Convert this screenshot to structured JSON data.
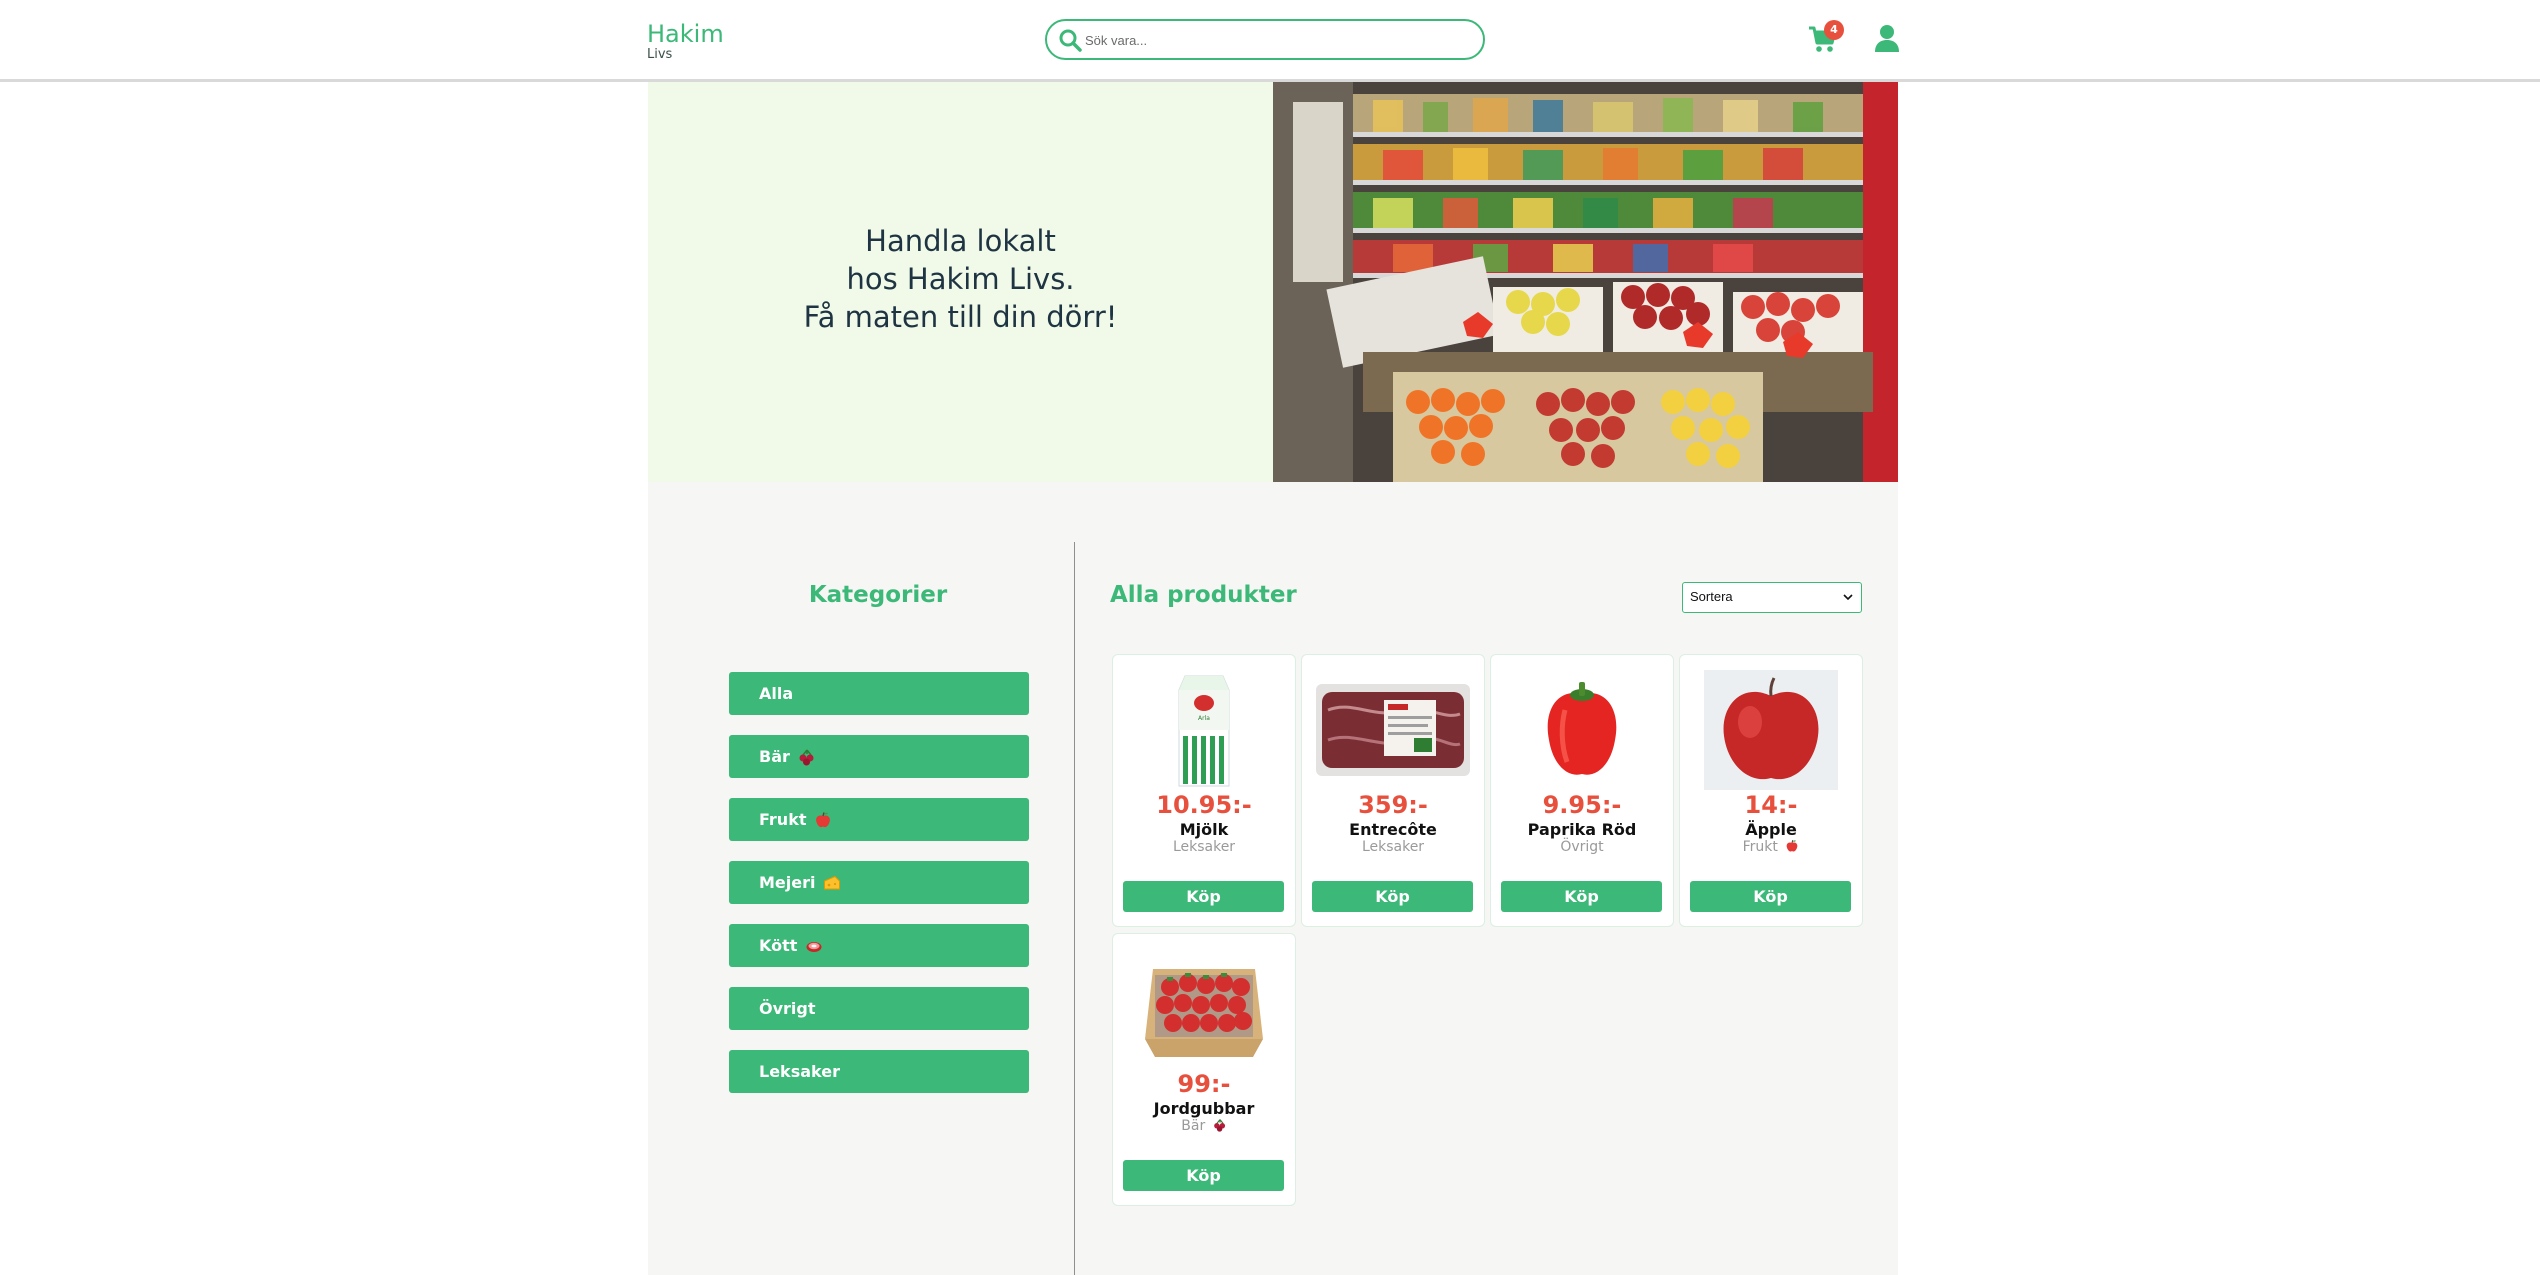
{
  "brand": {
    "name": "Hakim",
    "sub": "Livs"
  },
  "search": {
    "placeholder": "Sök vara...",
    "value": ""
  },
  "cart": {
    "count": "4"
  },
  "colors": {
    "accent": "#3cb878",
    "price": "#e8503e",
    "badge": "#e8503e",
    "hero_bg": "#f1fae9"
  },
  "hero": {
    "line1": "Handla lokalt",
    "line2": "hos Hakim Livs.",
    "line3": "Få maten till din dörr!"
  },
  "categories": {
    "title": "Kategorier",
    "items": [
      {
        "label": "Alla",
        "icon": ""
      },
      {
        "label": "Bär",
        "icon": "berries-emoji"
      },
      {
        "label": "Frukt",
        "icon": "apple-emoji"
      },
      {
        "label": "Mejeri",
        "icon": "cheese-emoji"
      },
      {
        "label": "Kött",
        "icon": "meat-emoji"
      },
      {
        "label": "Övrigt",
        "icon": ""
      },
      {
        "label": "Leksaker",
        "icon": ""
      }
    ]
  },
  "products": {
    "title": "Alla produkter",
    "sort_label": "Sortera",
    "buy_label": "Köp",
    "items": [
      {
        "price": "10.95:-",
        "name": "Mjölk",
        "category": "Leksaker",
        "icon": "",
        "image": "milk-carton"
      },
      {
        "price": "359:-",
        "name": "Entrecôte",
        "category": "Leksaker",
        "icon": "",
        "image": "entrecote-package"
      },
      {
        "price": "9.95:-",
        "name": "Paprika Röd",
        "category": "Övrigt",
        "icon": "",
        "image": "red-pepper"
      },
      {
        "price": "14:-",
        "name": "Äpple",
        "category": "Frukt",
        "icon": "apple-emoji",
        "image": "red-apple"
      },
      {
        "price": "99:-",
        "name": "Jordgubbar",
        "category": "Bär",
        "icon": "berries-emoji",
        "image": "strawberry-box"
      }
    ]
  }
}
